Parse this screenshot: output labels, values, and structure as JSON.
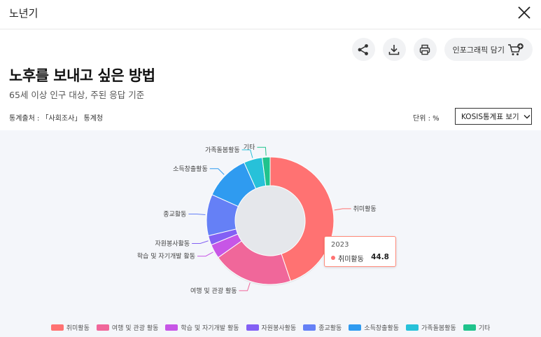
{
  "header": {
    "title": "노년기"
  },
  "toolbar": {
    "infographic_label": "인포그래픽 담기"
  },
  "page": {
    "title": "노후를 보내고 싶은 방법",
    "subtitle": "65세 이상 인구 대상, 주된 응답 기준",
    "source": "통계출처 : 「사회조사」 통계청",
    "unit": "단위 : %",
    "kosis_label": "KOSIS통계표 보기"
  },
  "tooltip": {
    "year": "2023",
    "name": "취미활동",
    "value": "44.8"
  },
  "chart_data": {
    "type": "pie",
    "variant": "donut",
    "year": "2023",
    "legend_position": "bottom",
    "categories": [
      "취미활동",
      "여행 및 관광 활동",
      "학습 및 자기개발 활동",
      "자원봉사활동",
      "종교활동",
      "소득창출활동",
      "가족돌봄활동",
      "기타"
    ],
    "values": [
      44.8,
      20.4,
      3.6,
      2.4,
      10.5,
      11.6,
      4.7,
      2.0
    ],
    "colors": [
      "#ff7272",
      "#f0679a",
      "#c756e6",
      "#8360f4",
      "#6580f6",
      "#2f9bf0",
      "#27c1d9",
      "#20c38c"
    ]
  }
}
